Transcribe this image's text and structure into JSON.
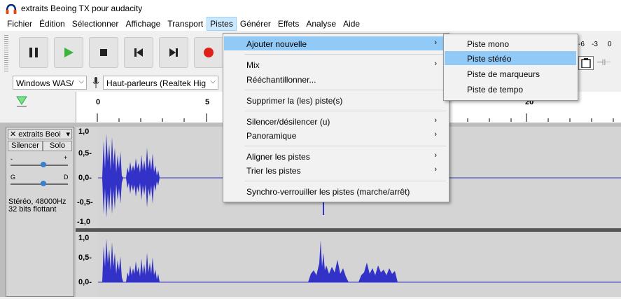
{
  "window": {
    "title": "extraits Beoing TX pour audacity"
  },
  "menubar": [
    "Fichier",
    "Édition",
    "Sélectionner",
    "Affichage",
    "Transport",
    "Pistes",
    "Générer",
    "Effets",
    "Analyse",
    "Aide"
  ],
  "active_menu_index": 5,
  "devices": {
    "host": "Windows WAS/",
    "output": "Haut-parleurs (Realtek Hig"
  },
  "timeline": {
    "ticks": [
      "0",
      "5",
      "20"
    ]
  },
  "meter": {
    "labels": [
      "-6",
      "-3",
      "0"
    ]
  },
  "track": {
    "name": "extraits Beoi",
    "mute": "Silencer",
    "solo": "Solo",
    "gain_minus": "-",
    "gain_plus": "+",
    "pan_left": "G",
    "pan_right": "D",
    "info_line1": "Stéréo, 48000Hz",
    "info_line2": "32 bits flottant"
  },
  "vruler": [
    "1,0",
    "0,5-",
    "0,0-",
    "-0,5-",
    "-1,0",
    "1,0",
    "0,5-",
    "0,0-"
  ],
  "pistes_menu": [
    {
      "label": "Ajouter nouvelle",
      "submenu": true,
      "highlight": true
    },
    {
      "label": "Mix",
      "submenu": true
    },
    {
      "label": "Rééchantillonner...",
      "submenu": false
    },
    {
      "label": "Supprimer la (les) piste(s)",
      "submenu": false
    },
    {
      "label": "Silencer/désilencer (u)",
      "submenu": true
    },
    {
      "label": "Panoramique",
      "submenu": true
    },
    {
      "label": "Aligner les pistes",
      "submenu": true
    },
    {
      "label": "Trier les pistes",
      "submenu": true
    },
    {
      "label": "Synchro-verrouiller les pistes (marche/arrêt)",
      "submenu": false
    }
  ],
  "submenu": [
    "Piste mono",
    "Piste stéréo",
    "Piste de marqueurs",
    "Piste de tempo"
  ],
  "submenu_highlight_index": 1,
  "colors": {
    "waveform": "#3232c8",
    "highlight": "#91c9f7",
    "record": "#e0201b",
    "play": "#3cb43c"
  }
}
